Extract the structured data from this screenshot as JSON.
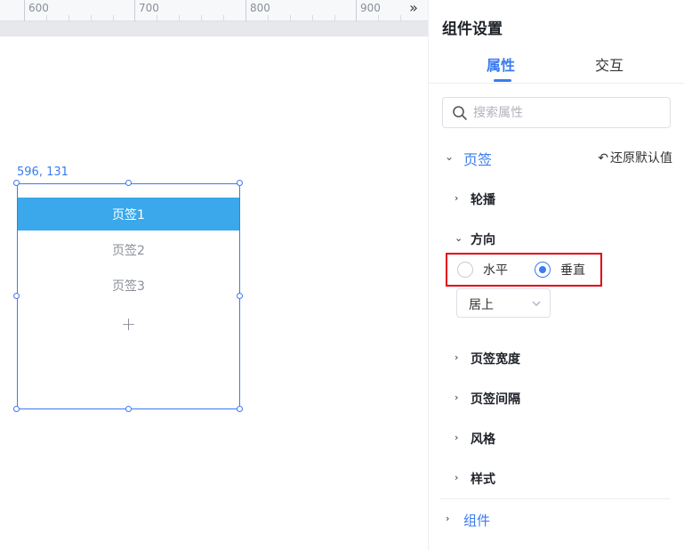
{
  "ruler": {
    "labels": [
      "600",
      "700",
      "800",
      "900"
    ],
    "collapse_icon": "»"
  },
  "canvas": {
    "coord_text": "596, 131",
    "tabs": [
      {
        "label": "页签1",
        "active": true
      },
      {
        "label": "页签2",
        "active": false
      },
      {
        "label": "页签3",
        "active": false
      }
    ],
    "add_symbol": "+"
  },
  "panel": {
    "title": "组件设置",
    "tabs": [
      {
        "label": "属性",
        "active": true
      },
      {
        "label": "交互",
        "active": false
      }
    ],
    "search_placeholder": "搜索属性",
    "section": {
      "label": "页签",
      "reset_label": "还原默认值"
    },
    "groups": {
      "carousel": "轮播",
      "direction": "方向",
      "tab_width": "页签宽度",
      "tab_spacing": "页签间隔",
      "style_group": "风格",
      "appearance": "样式"
    },
    "direction_options": [
      {
        "label": "水平",
        "checked": false
      },
      {
        "label": "垂直",
        "checked": true
      }
    ],
    "align_select": "居上",
    "footer_section": "组件"
  },
  "colors": {
    "accent": "#3a7bf0",
    "active_tab": "#3aa8ea",
    "highlight_box": "#e3000f"
  }
}
